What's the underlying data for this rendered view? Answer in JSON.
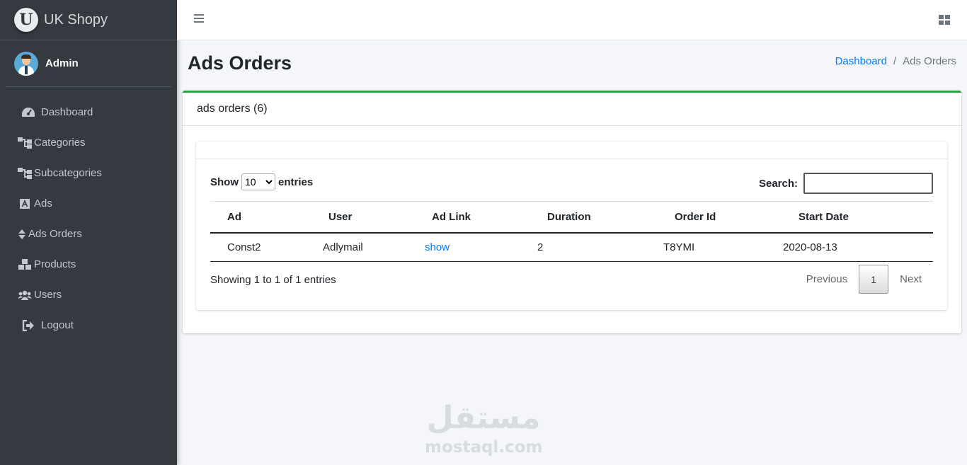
{
  "brand": {
    "logo_letter": "U",
    "name": "UK Shopy"
  },
  "user": {
    "name": "Admin"
  },
  "sidebar": {
    "items": [
      {
        "label": "Dashboard",
        "icon": "tachometer-icon"
      },
      {
        "label": "Categories",
        "icon": "sitemap-icon"
      },
      {
        "label": "Subcategories",
        "icon": "sitemap-icon"
      },
      {
        "label": "Ads",
        "icon": "ad-icon"
      },
      {
        "label": "Ads Orders",
        "icon": "sort-icon"
      },
      {
        "label": "Products",
        "icon": "boxes-icon"
      },
      {
        "label": "Users",
        "icon": "users-icon"
      },
      {
        "label": "Logout",
        "icon": "sign-out-icon"
      }
    ]
  },
  "page": {
    "title": "Ads Orders"
  },
  "breadcrumb": {
    "home": "Dashboard",
    "separator": "/",
    "current": "Ads Orders"
  },
  "card": {
    "title": "ads orders (6)"
  },
  "datatable": {
    "show_label": "Show",
    "entries_label": "entries",
    "page_length": "10",
    "search_label": "Search:",
    "search_value": "",
    "columns": [
      "Ad",
      "User",
      "Ad Link",
      "Duration",
      "Order Id",
      "Start Date"
    ],
    "rows": [
      {
        "ad": "Const2",
        "user": "Adlymail",
        "link": "show",
        "duration": "2",
        "order_id": "T8YMI",
        "start_date": "2020-08-13"
      }
    ],
    "info": "Showing 1 to 1 of 1 entries",
    "pagination": {
      "previous": "Previous",
      "current": "1",
      "next": "Next"
    }
  },
  "watermark": {
    "arabic": "مستقل",
    "latin": "mostaql.com"
  },
  "colors": {
    "sidebar_bg": "#343a40",
    "accent": "#28a745",
    "link": "#007bff",
    "page_bg": "#f4f6f9"
  }
}
